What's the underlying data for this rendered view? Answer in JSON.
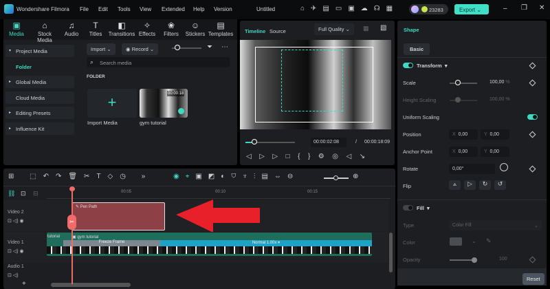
{
  "app": {
    "title": "Wondershare Filmora",
    "project": "Untitled",
    "credits": "23283",
    "export": "Export"
  },
  "menu": [
    "File",
    "Edit",
    "Tools",
    "View",
    "Extended",
    "Help",
    "Version"
  ],
  "tabs": [
    {
      "label": "Media",
      "icon": "▣"
    },
    {
      "label": "Stock Media",
      "icon": "⌂"
    },
    {
      "label": "Audio",
      "icon": "♫"
    },
    {
      "label": "Titles",
      "icon": "T"
    },
    {
      "label": "Transitions",
      "icon": "◧"
    },
    {
      "label": "Effects",
      "icon": "✧"
    },
    {
      "label": "Filters",
      "icon": "❀"
    },
    {
      "label": "Stickers",
      "icon": "☺"
    },
    {
      "label": "Templates",
      "icon": "▤"
    }
  ],
  "sidebar": [
    "Project Media",
    "Folder",
    "Global Media",
    "Cloud Media",
    "Editing Presets",
    "Influence Kit"
  ],
  "media": {
    "import": "Import",
    "record": "Record",
    "search_placeholder": "Search media",
    "folder_heading": "FOLDER",
    "import_media": "Import Media",
    "clip_name": "gym tutorial",
    "clip_duration": "00:00:18"
  },
  "preview": {
    "tab_timeline": "Timeline",
    "tab_source": "Source",
    "quality": "Full Quality",
    "current": "00:00:02:08",
    "separator": "/",
    "total": "00:00:18:09",
    "progress": 0.13
  },
  "properties": {
    "header": "Shape",
    "tab": "Basic",
    "transform": "Transform",
    "scale_label": "Scale",
    "scale": "100,00",
    "pct": "%",
    "height_label": "Height Scaling",
    "height": "100,00",
    "uniform": "Uniform Scaling",
    "position": "Position",
    "anchor": "Anchor Point",
    "x": "X",
    "y": "Y",
    "zero": "0,00",
    "rotate": "Rotate",
    "rotate_val": "0,00°",
    "flip": "Flip",
    "fill": "Fill",
    "type_label": "Type",
    "type_val": "Color Fill",
    "color_label": "Color",
    "opacity_label": "Opacity",
    "opacity": "100",
    "reset": "Reset"
  },
  "timeline": {
    "ticks": [
      "00:05",
      "00:10",
      "00:15"
    ],
    "tracks": [
      "Video 2",
      "Video 1",
      "Audio 1"
    ],
    "pen_clip": "Pen Path",
    "video_clip": "gym tutorial",
    "video_prev": "tutorial",
    "freeze": "Freeze Frame",
    "speed": "Normal 1.00x"
  },
  "colors": {
    "accent": "#3fd9c1",
    "clip_red": "#8d4146",
    "arrow": "#e8202a",
    "playhead": "#f06a6a"
  }
}
